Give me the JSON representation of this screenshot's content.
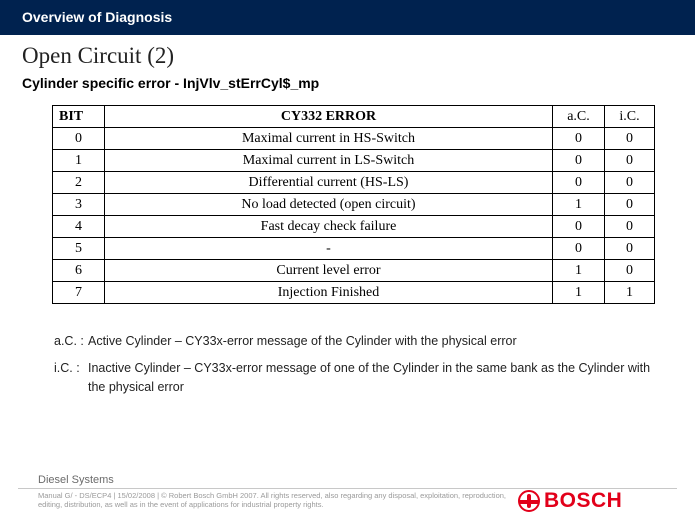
{
  "header": "Overview of Diagnosis",
  "title": "Open Circuit (2)",
  "subtitle": "Cylinder specific error - InjVlv_stErrCyl$_mp",
  "table": {
    "headers": {
      "bit": "BIT",
      "err": "CY332 ERROR",
      "ac": "a.C.",
      "ic": "i.C."
    },
    "rows": [
      {
        "bit": "0",
        "err": "Maximal current in HS-Switch",
        "ac": "0",
        "ic": "0"
      },
      {
        "bit": "1",
        "err": "Maximal current in LS-Switch",
        "ac": "0",
        "ic": "0"
      },
      {
        "bit": "2",
        "err": "Differential current (HS-LS)",
        "ac": "0",
        "ic": "0"
      },
      {
        "bit": "3",
        "err": "No load detected (open circuit)",
        "ac": "1",
        "ic": "0"
      },
      {
        "bit": "4",
        "err": "Fast decay check failure",
        "ac": "0",
        "ic": "0"
      },
      {
        "bit": "5",
        "err": "-",
        "ac": "0",
        "ic": "0"
      },
      {
        "bit": "6",
        "err": "Current level error",
        "ac": "1",
        "ic": "0"
      },
      {
        "bit": "7",
        "err": "Injection Finished",
        "ac": "1",
        "ic": "1"
      }
    ]
  },
  "legend": {
    "ac": {
      "lbl": "a.C. :",
      "txt": "Active Cylinder – CY33x-error message of the Cylinder with the physical error"
    },
    "ic": {
      "lbl": "i.C. :",
      "txt": "Inactive Cylinder – CY33x-error message of one of the Cylinder in the same bank as the Cylinder with the physical error"
    }
  },
  "footer": {
    "label": "Diesel Systems",
    "disclaimer": "Manual G/ - DS/ECP4 | 15/02/2008 | © Robert Bosch GmbH 2007. All rights reserved, also regarding any disposal, exploitation, reproduction, editing, distribution, as well as in the event of applications for industrial property rights.",
    "logo": "BOSCH"
  }
}
